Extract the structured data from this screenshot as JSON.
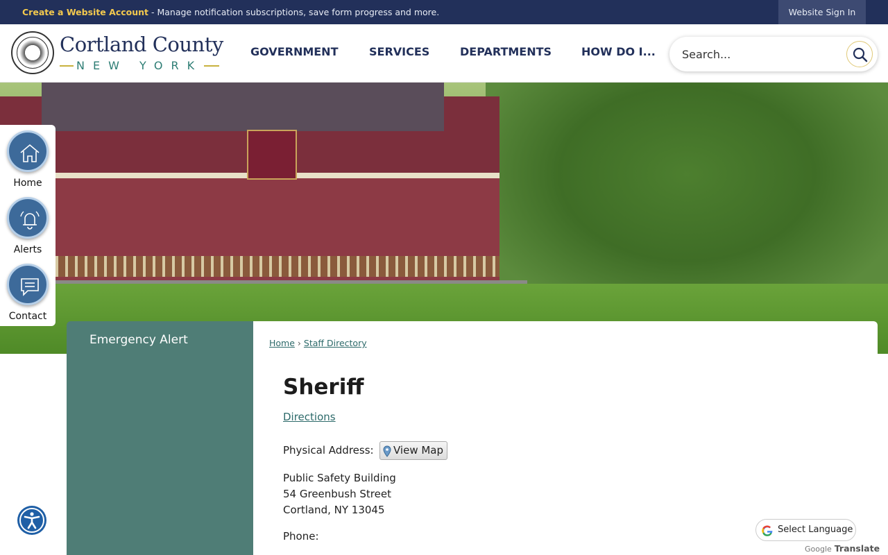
{
  "topbar": {
    "create_account_link": "Create a Website Account",
    "create_account_text": " - Manage notification subscriptions, save form progress and more.",
    "sign_in": "Website Sign In"
  },
  "header": {
    "logo_title": "Cortland County",
    "logo_subtitle": "NEW YORK",
    "nav": [
      "GOVERNMENT",
      "SERVICES",
      "DEPARTMENTS",
      "HOW DO I..."
    ],
    "search_placeholder": "Search..."
  },
  "quick_links": [
    {
      "label": "Home",
      "icon": "home-icon"
    },
    {
      "label": "Alerts",
      "icon": "bell-icon"
    },
    {
      "label": "Contact",
      "icon": "chat-icon"
    }
  ],
  "sidebar": {
    "emergency_alert": "Emergency Alert"
  },
  "breadcrumb": {
    "home": "Home",
    "separator": "›",
    "current": "Staff Directory"
  },
  "page": {
    "title": "Sheriff",
    "directions": "Directions",
    "physical_address_label": "Physical Address:",
    "view_map": "View Map",
    "address_lines": [
      "Public Safety Building",
      "54 Greenbush Street",
      "Cortland, NY 13045"
    ],
    "phone_label": "Phone:"
  },
  "translate": {
    "select_language": "Select Language",
    "powered_google": "Google",
    "powered_translate": "Translate"
  },
  "colors": {
    "topbar": "#22305a",
    "accent_yellow": "#f3c94e",
    "sidebar": "#4f7d76",
    "link": "#2d6a6a",
    "quick_link_circle": "#3d6a9a"
  }
}
